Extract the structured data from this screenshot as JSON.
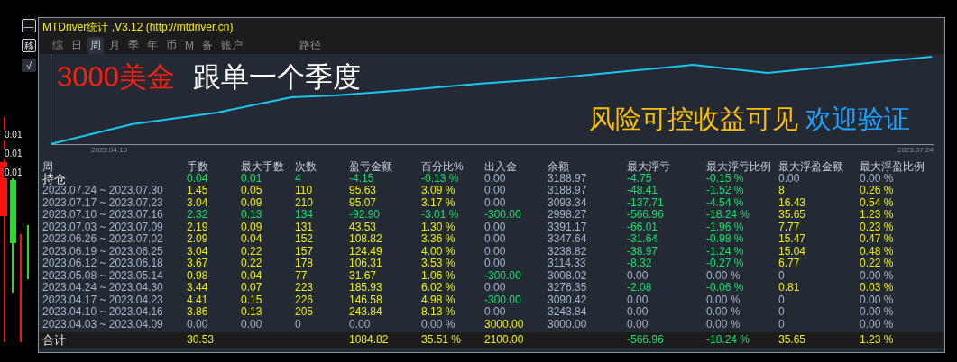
{
  "side_buttons": [
    {
      "label": "—",
      "kind": "box"
    },
    {
      "label": "移",
      "kind": "box"
    },
    {
      "label": "√",
      "kind": "fill"
    }
  ],
  "axis_labels": [
    "0.01",
    "0.01",
    "0.01"
  ],
  "window": {
    "title": "MTDriver统计 ,V3.12 (http://mtdriver.cn)"
  },
  "tabs": [
    {
      "label": "综",
      "selected": false
    },
    {
      "label": "日",
      "selected": false
    },
    {
      "label": "周",
      "selected": true
    },
    {
      "label": "月",
      "selected": false
    },
    {
      "label": "季",
      "selected": false
    },
    {
      "label": "年",
      "selected": false
    },
    {
      "label": "币",
      "selected": false
    },
    {
      "label": "M",
      "selected": false
    },
    {
      "label": "备",
      "selected": false
    },
    {
      "label": "账户",
      "selected": false
    },
    {
      "label": "路径",
      "selected": false
    }
  ],
  "chart": {
    "headline": [
      "3000美金",
      "跟单一个季度"
    ],
    "slogan": [
      "风险可控收益可见",
      "欢迎验证"
    ],
    "start_date": "2023.04.10",
    "end_date": "2023.07.24"
  },
  "table": {
    "columns": [
      "周",
      "手数",
      "最大手数",
      "次数",
      "盈亏金额",
      "百分比%",
      "出入金",
      "余额",
      "最大浮亏",
      "最大浮亏比例",
      "最大浮盈金额",
      "最大浮盈比例"
    ],
    "rows": [
      {
        "kind": "open",
        "cells": [
          {
            "text": "持仓",
            "color": "#e8ecf0"
          },
          {
            "text": "0.04",
            "color": "#10e070"
          },
          {
            "text": "0.01",
            "color": "#10e070"
          },
          {
            "text": "4",
            "color": "#10e070"
          },
          {
            "text": "-4.15",
            "color": "#10e070"
          },
          {
            "text": "-0.13 %",
            "color": "#10e070"
          },
          {
            "text": "0.00",
            "color": "#a8b4c8"
          },
          {
            "text": "3188.97",
            "color": "#a8b4c8"
          },
          {
            "text": "-4.75",
            "color": "#10e070"
          },
          {
            "text": "-0.15 %",
            "color": "#10e070"
          },
          {
            "text": "0.00",
            "color": "#a8b4c8"
          },
          {
            "text": "0.00 %",
            "color": "#a8b4c8"
          }
        ]
      },
      {
        "kind": "week",
        "cells": [
          {
            "text": "2023.07.24 ~ 2023.07.30",
            "color": "#a8b4c8"
          },
          {
            "text": "1.45",
            "color": "#f0f000"
          },
          {
            "text": "0.05",
            "color": "#f0f000"
          },
          {
            "text": "110",
            "color": "#f0f000"
          },
          {
            "text": "95.63",
            "color": "#f0f000"
          },
          {
            "text": "3.09 %",
            "color": "#f0f000"
          },
          {
            "text": "0.00",
            "color": "#a8b4c8"
          },
          {
            "text": "3188.97",
            "color": "#a8b4c8"
          },
          {
            "text": "-48.41",
            "color": "#10e070"
          },
          {
            "text": "-1.52 %",
            "color": "#10e070"
          },
          {
            "text": "8",
            "color": "#f0f000"
          },
          {
            "text": "0.26 %",
            "color": "#f0f000"
          }
        ]
      },
      {
        "kind": "week",
        "cells": [
          {
            "text": "2023.07.17 ~ 2023.07.23",
            "color": "#a8b4c8"
          },
          {
            "text": "3.04",
            "color": "#f0f000"
          },
          {
            "text": "0.09",
            "color": "#f0f000"
          },
          {
            "text": "210",
            "color": "#f0f000"
          },
          {
            "text": "95.07",
            "color": "#f0f000"
          },
          {
            "text": "3.17 %",
            "color": "#f0f000"
          },
          {
            "text": "0.00",
            "color": "#a8b4c8"
          },
          {
            "text": "3093.34",
            "color": "#a8b4c8"
          },
          {
            "text": "-137.71",
            "color": "#10e070"
          },
          {
            "text": "-4.54 %",
            "color": "#10e070"
          },
          {
            "text": "16.43",
            "color": "#f0f000"
          },
          {
            "text": "0.54 %",
            "color": "#f0f000"
          }
        ]
      },
      {
        "kind": "week",
        "cells": [
          {
            "text": "2023.07.10 ~ 2023.07.16",
            "color": "#a8b4c8"
          },
          {
            "text": "2.32",
            "color": "#10e070"
          },
          {
            "text": "0.13",
            "color": "#10e070"
          },
          {
            "text": "134",
            "color": "#10e070"
          },
          {
            "text": "-92.90",
            "color": "#10e070"
          },
          {
            "text": "-3.01 %",
            "color": "#10e070"
          },
          {
            "text": "-300.00",
            "color": "#10e070"
          },
          {
            "text": "2998.27",
            "color": "#a8b4c8"
          },
          {
            "text": "-566.96",
            "color": "#10e070"
          },
          {
            "text": "-18.24 %",
            "color": "#10e070"
          },
          {
            "text": "35.65",
            "color": "#f0f000"
          },
          {
            "text": "1.23 %",
            "color": "#f0f000"
          }
        ]
      },
      {
        "kind": "week",
        "cells": [
          {
            "text": "2023.07.03 ~ 2023.07.09",
            "color": "#a8b4c8"
          },
          {
            "text": "2.19",
            "color": "#f0f000"
          },
          {
            "text": "0.09",
            "color": "#f0f000"
          },
          {
            "text": "131",
            "color": "#f0f000"
          },
          {
            "text": "43.53",
            "color": "#f0f000"
          },
          {
            "text": "1.30 %",
            "color": "#f0f000"
          },
          {
            "text": "0.00",
            "color": "#a8b4c8"
          },
          {
            "text": "3391.17",
            "color": "#a8b4c8"
          },
          {
            "text": "-66.01",
            "color": "#10e070"
          },
          {
            "text": "-1.96 %",
            "color": "#10e070"
          },
          {
            "text": "7.77",
            "color": "#f0f000"
          },
          {
            "text": "0.23 %",
            "color": "#f0f000"
          }
        ]
      },
      {
        "kind": "week",
        "cells": [
          {
            "text": "2023.06.26 ~ 2023.07.02",
            "color": "#a8b4c8"
          },
          {
            "text": "2.09",
            "color": "#f0f000"
          },
          {
            "text": "0.04",
            "color": "#f0f000"
          },
          {
            "text": "152",
            "color": "#f0f000"
          },
          {
            "text": "108.82",
            "color": "#f0f000"
          },
          {
            "text": "3.36 %",
            "color": "#f0f000"
          },
          {
            "text": "0.00",
            "color": "#a8b4c8"
          },
          {
            "text": "3347.64",
            "color": "#a8b4c8"
          },
          {
            "text": "-31.64",
            "color": "#10e070"
          },
          {
            "text": "-0.98 %",
            "color": "#10e070"
          },
          {
            "text": "15.47",
            "color": "#f0f000"
          },
          {
            "text": "0.47 %",
            "color": "#f0f000"
          }
        ]
      },
      {
        "kind": "week",
        "cells": [
          {
            "text": "2023.06.19 ~ 2023.06.25",
            "color": "#a8b4c8"
          },
          {
            "text": "3.04",
            "color": "#f0f000"
          },
          {
            "text": "0.22",
            "color": "#f0f000"
          },
          {
            "text": "157",
            "color": "#f0f000"
          },
          {
            "text": "124.49",
            "color": "#f0f000"
          },
          {
            "text": "4.00 %",
            "color": "#f0f000"
          },
          {
            "text": "0.00",
            "color": "#a8b4c8"
          },
          {
            "text": "3238.82",
            "color": "#a8b4c8"
          },
          {
            "text": "-38.97",
            "color": "#10e070"
          },
          {
            "text": "-1.24 %",
            "color": "#10e070"
          },
          {
            "text": "15.04",
            "color": "#f0f000"
          },
          {
            "text": "0.48 %",
            "color": "#f0f000"
          }
        ]
      },
      {
        "kind": "week",
        "cells": [
          {
            "text": "2023.06.12 ~ 2023.06.18",
            "color": "#a8b4c8"
          },
          {
            "text": "3.67",
            "color": "#f0f000"
          },
          {
            "text": "0.22",
            "color": "#f0f000"
          },
          {
            "text": "178",
            "color": "#f0f000"
          },
          {
            "text": "106.31",
            "color": "#f0f000"
          },
          {
            "text": "3.53 %",
            "color": "#f0f000"
          },
          {
            "text": "0.00",
            "color": "#a8b4c8"
          },
          {
            "text": "3114.33",
            "color": "#a8b4c8"
          },
          {
            "text": "-8.32",
            "color": "#10e070"
          },
          {
            "text": "-0.27 %",
            "color": "#10e070"
          },
          {
            "text": "6.77",
            "color": "#f0f000"
          },
          {
            "text": "0.22 %",
            "color": "#f0f000"
          }
        ]
      },
      {
        "kind": "week",
        "cells": [
          {
            "text": "2023.05.08 ~ 2023.05.14",
            "color": "#a8b4c8"
          },
          {
            "text": "0.98",
            "color": "#f0f000"
          },
          {
            "text": "0.04",
            "color": "#f0f000"
          },
          {
            "text": "77",
            "color": "#f0f000"
          },
          {
            "text": "31.67",
            "color": "#f0f000"
          },
          {
            "text": "1.06 %",
            "color": "#f0f000"
          },
          {
            "text": "-300.00",
            "color": "#10e070"
          },
          {
            "text": "3008.02",
            "color": "#a8b4c8"
          },
          {
            "text": "0.00",
            "color": "#a8b4c8"
          },
          {
            "text": "0.00 %",
            "color": "#a8b4c8"
          },
          {
            "text": "0",
            "color": "#a8b4c8"
          },
          {
            "text": "0.00 %",
            "color": "#a8b4c8"
          }
        ]
      },
      {
        "kind": "week",
        "cells": [
          {
            "text": "2023.04.24 ~ 2023.04.30",
            "color": "#a8b4c8"
          },
          {
            "text": "3.44",
            "color": "#f0f000"
          },
          {
            "text": "0.07",
            "color": "#f0f000"
          },
          {
            "text": "223",
            "color": "#f0f000"
          },
          {
            "text": "185.93",
            "color": "#f0f000"
          },
          {
            "text": "6.02 %",
            "color": "#f0f000"
          },
          {
            "text": "0.00",
            "color": "#a8b4c8"
          },
          {
            "text": "3276.35",
            "color": "#a8b4c8"
          },
          {
            "text": "-2.08",
            "color": "#10e070"
          },
          {
            "text": "-0.06 %",
            "color": "#10e070"
          },
          {
            "text": "0.81",
            "color": "#f0f000"
          },
          {
            "text": "0.03 %",
            "color": "#f0f000"
          }
        ]
      },
      {
        "kind": "week",
        "cells": [
          {
            "text": "2023.04.17 ~ 2023.04.23",
            "color": "#a8b4c8"
          },
          {
            "text": "4.41",
            "color": "#f0f000"
          },
          {
            "text": "0.15",
            "color": "#f0f000"
          },
          {
            "text": "226",
            "color": "#f0f000"
          },
          {
            "text": "146.58",
            "color": "#f0f000"
          },
          {
            "text": "4.98 %",
            "color": "#f0f000"
          },
          {
            "text": "-300.00",
            "color": "#10e070"
          },
          {
            "text": "3090.42",
            "color": "#a8b4c8"
          },
          {
            "text": "0.00",
            "color": "#a8b4c8"
          },
          {
            "text": "0.00 %",
            "color": "#a8b4c8"
          },
          {
            "text": "0",
            "color": "#a8b4c8"
          },
          {
            "text": "0.00 %",
            "color": "#a8b4c8"
          }
        ]
      },
      {
        "kind": "week",
        "cells": [
          {
            "text": "2023.04.10 ~ 2023.04.16",
            "color": "#a8b4c8"
          },
          {
            "text": "3.86",
            "color": "#f0f000"
          },
          {
            "text": "0.13",
            "color": "#f0f000"
          },
          {
            "text": "205",
            "color": "#f0f000"
          },
          {
            "text": "243.84",
            "color": "#f0f000"
          },
          {
            "text": "8.13 %",
            "color": "#f0f000"
          },
          {
            "text": "0.00",
            "color": "#a8b4c8"
          },
          {
            "text": "3243.84",
            "color": "#a8b4c8"
          },
          {
            "text": "0.00",
            "color": "#a8b4c8"
          },
          {
            "text": "0.00 %",
            "color": "#a8b4c8"
          },
          {
            "text": "0",
            "color": "#a8b4c8"
          },
          {
            "text": "0.00 %",
            "color": "#a8b4c8"
          }
        ]
      },
      {
        "kind": "week",
        "cells": [
          {
            "text": "2023.04.03 ~ 2023.04.09",
            "color": "#a8b4c8"
          },
          {
            "text": "0.00",
            "color": "#a8b4c8"
          },
          {
            "text": "0.00",
            "color": "#a8b4c8"
          },
          {
            "text": "0",
            "color": "#a8b4c8"
          },
          {
            "text": "0.00",
            "color": "#a8b4c8"
          },
          {
            "text": "0.00 %",
            "color": "#a8b4c8"
          },
          {
            "text": "3000.00",
            "color": "#f0f000"
          },
          {
            "text": "3000.00",
            "color": "#a8b4c8"
          },
          {
            "text": "0.00",
            "color": "#a8b4c8"
          },
          {
            "text": "0.00 %",
            "color": "#a8b4c8"
          },
          {
            "text": "0",
            "color": "#a8b4c8"
          },
          {
            "text": "0.00 %",
            "color": "#a8b4c8"
          }
        ]
      },
      {
        "kind": "total",
        "cells": [
          {
            "text": "合计",
            "color": "#e8ecf0"
          },
          {
            "text": "30.53",
            "color": "#f0f000"
          },
          null,
          null,
          {
            "text": "1084.82",
            "color": "#f0f000"
          },
          {
            "text": "35.51 %",
            "color": "#f0f000"
          },
          {
            "text": "2100.00",
            "color": "#f0f000"
          },
          null,
          {
            "text": "-566.96",
            "color": "#10e070"
          },
          {
            "text": "-18.24 %",
            "color": "#10e070"
          },
          {
            "text": "35.65",
            "color": "#f0f000"
          },
          {
            "text": "1.23 %",
            "color": "#f0f000"
          }
        ]
      }
    ]
  }
}
